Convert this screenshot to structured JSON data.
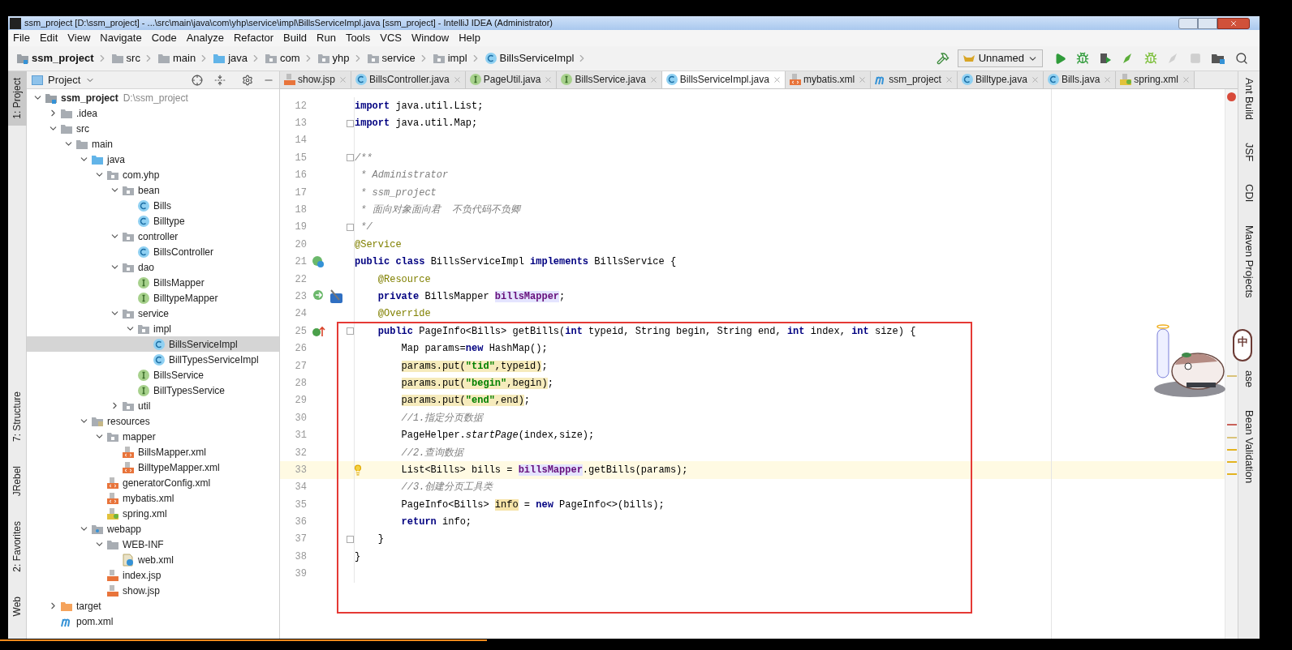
{
  "window": {
    "title": "ssm_project [D:\\ssm_project] - ...\\src\\main\\java\\com\\yhp\\service\\impl\\BillsServiceImpl.java [ssm_project] - IntelliJ IDEA (Administrator)"
  },
  "menu": [
    "File",
    "Edit",
    "View",
    "Navigate",
    "Code",
    "Analyze",
    "Refactor",
    "Build",
    "Run",
    "Tools",
    "VCS",
    "Window",
    "Help"
  ],
  "breadcrumbs": [
    {
      "label": "ssm_project",
      "kind": "module"
    },
    {
      "label": "src",
      "kind": "folder"
    },
    {
      "label": "main",
      "kind": "folder"
    },
    {
      "label": "java",
      "kind": "source"
    },
    {
      "label": "com",
      "kind": "package"
    },
    {
      "label": "yhp",
      "kind": "package"
    },
    {
      "label": "service",
      "kind": "package"
    },
    {
      "label": "impl",
      "kind": "package"
    },
    {
      "label": "BillsServiceImpl",
      "kind": "class"
    }
  ],
  "run_config": "Unnamed",
  "left_tools": [
    {
      "label": "1: Project",
      "selected": true
    },
    {
      "label": "7: Structure",
      "selected": false
    },
    {
      "label": "JRebel",
      "selected": false
    },
    {
      "label": "2: Favorites",
      "selected": false
    },
    {
      "label": "Web",
      "selected": false
    }
  ],
  "right_tools": [
    "Ant Build",
    "JSF",
    "CDI",
    "Maven Projects",
    "ase",
    "Bean Validation"
  ],
  "project_panel": {
    "title": "Project",
    "tree": [
      {
        "name": "ssm_project",
        "kind": "module",
        "bold": true,
        "path": "D:\\ssm_project",
        "expanded": true,
        "selected": false,
        "children": [
          {
            "name": ".idea",
            "kind": "folder",
            "bold": false,
            "expanded": false,
            "selected": false
          },
          {
            "name": "src",
            "kind": "folder",
            "bold": false,
            "expanded": true,
            "selected": false,
            "children": [
              {
                "name": "main",
                "kind": "folder",
                "bold": false,
                "expanded": true,
                "selected": false,
                "children": [
                  {
                    "name": "java",
                    "kind": "source",
                    "bold": false,
                    "expanded": true,
                    "selected": false,
                    "children": [
                      {
                        "name": "com.yhp",
                        "kind": "package",
                        "bold": false,
                        "expanded": true,
                        "selected": false,
                        "children": [
                          {
                            "name": "bean",
                            "kind": "package",
                            "bold": false,
                            "expanded": true,
                            "selected": false,
                            "children": [
                              {
                                "name": "Bills",
                                "kind": "class",
                                "bold": false,
                                "selected": false
                              },
                              {
                                "name": "Billtype",
                                "kind": "class",
                                "bold": false,
                                "selected": false
                              }
                            ]
                          },
                          {
                            "name": "controller",
                            "kind": "package",
                            "bold": false,
                            "expanded": true,
                            "selected": false,
                            "children": [
                              {
                                "name": "BillsController",
                                "kind": "class",
                                "bold": false,
                                "selected": false
                              }
                            ]
                          },
                          {
                            "name": "dao",
                            "kind": "package",
                            "bold": false,
                            "expanded": true,
                            "selected": false,
                            "children": [
                              {
                                "name": "BillsMapper",
                                "kind": "interface",
                                "bold": false,
                                "selected": false
                              },
                              {
                                "name": "BilltypeMapper",
                                "kind": "interface",
                                "bold": false,
                                "selected": false
                              }
                            ]
                          },
                          {
                            "name": "service",
                            "kind": "package",
                            "bold": false,
                            "expanded": true,
                            "selected": false,
                            "children": [
                              {
                                "name": "impl",
                                "kind": "package",
                                "bold": false,
                                "expanded": true,
                                "selected": false,
                                "children": [
                                  {
                                    "name": "BillsServiceImpl",
                                    "kind": "class",
                                    "bold": false,
                                    "selected": true
                                  },
                                  {
                                    "name": "BillTypesServiceImpl",
                                    "kind": "class",
                                    "bold": false,
                                    "selected": false
                                  }
                                ]
                              },
                              {
                                "name": "BillsService",
                                "kind": "interface",
                                "bold": false,
                                "selected": false
                              },
                              {
                                "name": "BillTypesService",
                                "kind": "interface",
                                "bold": false,
                                "selected": false
                              }
                            ]
                          },
                          {
                            "name": "util",
                            "kind": "package",
                            "bold": false,
                            "expanded": false,
                            "selected": false
                          }
                        ]
                      }
                    ]
                  },
                  {
                    "name": "resources",
                    "kind": "resources",
                    "bold": false,
                    "expanded": true,
                    "selected": false,
                    "children": [
                      {
                        "name": "mapper",
                        "kind": "package",
                        "bold": false,
                        "expanded": true,
                        "selected": false,
                        "children": [
                          {
                            "name": "BillsMapper.xml",
                            "kind": "xml",
                            "bold": false,
                            "selected": false
                          },
                          {
                            "name": "BilltypeMapper.xml",
                            "kind": "xml",
                            "bold": false,
                            "selected": false
                          }
                        ]
                      },
                      {
                        "name": "generatorConfig.xml",
                        "kind": "xml",
                        "bold": false,
                        "selected": false
                      },
                      {
                        "name": "mybatis.xml",
                        "kind": "xml",
                        "bold": false,
                        "selected": false
                      },
                      {
                        "name": "spring.xml",
                        "kind": "spring",
                        "bold": false,
                        "selected": false
                      }
                    ]
                  },
                  {
                    "name": "webapp",
                    "kind": "web",
                    "bold": false,
                    "expanded": true,
                    "selected": false,
                    "children": [
                      {
                        "name": "WEB-INF",
                        "kind": "folder",
                        "bold": false,
                        "expanded": true,
                        "selected": false,
                        "children": [
                          {
                            "name": "web.xml",
                            "kind": "webxml",
                            "bold": false,
                            "selected": false
                          }
                        ]
                      },
                      {
                        "name": "index.jsp",
                        "kind": "jsp",
                        "bold": false,
                        "selected": false
                      },
                      {
                        "name": "show.jsp",
                        "kind": "jsp",
                        "bold": false,
                        "selected": false
                      }
                    ]
                  }
                ]
              }
            ]
          },
          {
            "name": "target",
            "kind": "excluded",
            "bold": false,
            "expanded": false,
            "selected": false
          },
          {
            "name": "pom.xml",
            "kind": "maven",
            "bold": false,
            "selected": false
          }
        ]
      }
    ]
  },
  "tabs": [
    {
      "label": "show.jsp",
      "kind": "jsp",
      "selected": false
    },
    {
      "label": "BillsController.java",
      "kind": "class",
      "selected": false
    },
    {
      "label": "PageUtil.java",
      "kind": "interface",
      "selected": false
    },
    {
      "label": "BillsService.java",
      "kind": "interface",
      "selected": false
    },
    {
      "label": "BillsServiceImpl.java",
      "kind": "class",
      "selected": true
    },
    {
      "label": "mybatis.xml",
      "kind": "xml",
      "selected": false
    },
    {
      "label": "ssm_project",
      "kind": "maven",
      "selected": false
    },
    {
      "label": "Billtype.java",
      "kind": "class",
      "selected": false
    },
    {
      "label": "Bills.java",
      "kind": "class",
      "selected": false
    },
    {
      "label": "spring.xml",
      "kind": "spring",
      "selected": false
    }
  ],
  "code_lines": [
    {
      "number": "12",
      "current": false,
      "fold": false,
      "tokens": [
        {
          "kind": "keyword",
          "text": "import"
        },
        {
          "kind": "plain",
          "text": " java.util.List;"
        }
      ]
    },
    {
      "number": "13",
      "current": false,
      "fold": true,
      "tokens": [
        {
          "kind": "keyword",
          "text": "import"
        },
        {
          "kind": "plain",
          "text": " java.util.Map;"
        }
      ]
    },
    {
      "number": "14",
      "current": false,
      "fold": false
    },
    {
      "number": "15",
      "current": false,
      "fold": true,
      "tokens": [
        {
          "kind": "comment",
          "text": "/**"
        }
      ]
    },
    {
      "number": "16",
      "current": false,
      "fold": false,
      "tokens": [
        {
          "kind": "comment",
          "text": " * Administrator"
        }
      ]
    },
    {
      "number": "17",
      "current": false,
      "fold": false,
      "tokens": [
        {
          "kind": "comment",
          "text": " * ssm_project"
        }
      ]
    },
    {
      "number": "18",
      "current": false,
      "fold": false,
      "tokens": [
        {
          "kind": "comment",
          "text": " * 面向对象面向君  不负代码不负卿"
        }
      ]
    },
    {
      "number": "19",
      "current": false,
      "fold": true,
      "tokens": [
        {
          "kind": "comment",
          "text": " */"
        }
      ]
    },
    {
      "number": "20",
      "current": false,
      "fold": false,
      "tokens": [
        {
          "kind": "annotation",
          "text": "@Service"
        }
      ]
    },
    {
      "number": "21",
      "current": false,
      "fold": false,
      "kind": "class",
      "tokens": [
        {
          "kind": "keyword",
          "text": "public class"
        },
        {
          "kind": "plain",
          "text": " BillsServiceImpl "
        },
        {
          "kind": "keyword",
          "text": "implements"
        },
        {
          "kind": "plain",
          "text": " BillsService {"
        }
      ]
    },
    {
      "number": "22",
      "current": false,
      "fold": false,
      "tokens": [
        {
          "kind": "annotation",
          "text": "    @Resource"
        }
      ]
    },
    {
      "number": "23",
      "current": false,
      "fold": false,
      "kind": "bean",
      "tokens": [
        {
          "kind": "keyword",
          "text": "    private"
        },
        {
          "kind": "plain",
          "text": " BillsMapper "
        },
        {
          "kind": "field",
          "text": "billsMapper"
        },
        {
          "kind": "plain",
          "text": ";"
        }
      ]
    },
    {
      "number": "24",
      "current": false,
      "fold": false,
      "tokens": [
        {
          "kind": "annotation",
          "text": "    @Override"
        }
      ]
    },
    {
      "number": "25",
      "current": false,
      "fold": true,
      "kind": "implements",
      "tokens": [
        {
          "kind": "keyword",
          "text": "    public"
        },
        {
          "kind": "plain",
          "text": " PageInfo<Bills> getBills("
        },
        {
          "kind": "keyword",
          "text": "int"
        },
        {
          "kind": "plain",
          "text": " typeid, String begin, String end, "
        },
        {
          "kind": "keyword",
          "text": "int"
        },
        {
          "kind": "plain",
          "text": " index, "
        },
        {
          "kind": "keyword",
          "text": "int"
        },
        {
          "kind": "plain",
          "text": " size) {"
        }
      ]
    },
    {
      "number": "26",
      "current": false,
      "fold": false,
      "tokens": [
        {
          "kind": "plain",
          "text": "        Map params="
        },
        {
          "kind": "keyword",
          "text": "new"
        },
        {
          "kind": "plain",
          "text": " HashMap();"
        }
      ]
    },
    {
      "number": "27",
      "current": false,
      "fold": false,
      "tokens": [
        {
          "kind": "warning",
          "text": "        params.put("
        },
        {
          "kind": "string",
          "text": "\"tid\""
        },
        {
          "kind": "warning",
          "text": ",typeid)"
        },
        {
          "kind": "plain",
          "text": ";"
        }
      ]
    },
    {
      "number": "28",
      "current": false,
      "fold": false,
      "tokens": [
        {
          "kind": "warning",
          "text": "        params.put("
        },
        {
          "kind": "string",
          "text": "\"begin\""
        },
        {
          "kind": "warning",
          "text": ",begin)"
        },
        {
          "kind": "plain",
          "text": ";"
        }
      ]
    },
    {
      "number": "29",
      "current": false,
      "fold": false,
      "tokens": [
        {
          "kind": "warning",
          "text": "        params.put("
        },
        {
          "kind": "string",
          "text": "\"end\""
        },
        {
          "kind": "warning",
          "text": ",end)"
        },
        {
          "kind": "plain",
          "text": ";"
        }
      ]
    },
    {
      "number": "30",
      "current": false,
      "fold": false,
      "tokens": [
        {
          "kind": "comment",
          "text": "        //1.指定分页数据"
        }
      ]
    },
    {
      "number": "31",
      "current": false,
      "fold": false,
      "tokens": [
        {
          "kind": "plain",
          "text": "        PageHelper."
        },
        {
          "kind": "static",
          "text": "startPage"
        },
        {
          "kind": "plain",
          "text": "(index,size);"
        }
      ]
    },
    {
      "number": "32",
      "current": false,
      "fold": false,
      "tokens": [
        {
          "kind": "comment",
          "text": "        //2.查询数据"
        }
      ]
    },
    {
      "number": "33",
      "current": true,
      "fold": false,
      "kind": "bulb",
      "tokens": [
        {
          "kind": "plain",
          "text": "        List<Bills> bills = "
        },
        {
          "kind": "field",
          "text": "billsMapper"
        },
        {
          "kind": "plain",
          "text": ".getBills(params);"
        }
      ]
    },
    {
      "number": "34",
      "current": false,
      "fold": false,
      "tokens": [
        {
          "kind": "comment",
          "text": "        //3.创建分页工具类"
        }
      ]
    },
    {
      "number": "35",
      "current": false,
      "fold": false,
      "tokens": [
        {
          "kind": "plain",
          "text": "        PageInfo<Bills> "
        },
        {
          "kind": "usage",
          "text": "info"
        },
        {
          "kind": "plain",
          "text": " = "
        },
        {
          "kind": "keyword",
          "text": "new"
        },
        {
          "kind": "plain",
          "text": " PageInfo<>(bills);"
        }
      ]
    },
    {
      "number": "36",
      "current": false,
      "fold": false,
      "tokens": [
        {
          "kind": "keyword",
          "text": "        return"
        },
        {
          "kind": "plain",
          "text": " info;"
        }
      ]
    },
    {
      "number": "37",
      "current": false,
      "fold": true,
      "tokens": [
        {
          "kind": "plain",
          "text": "    }"
        }
      ]
    },
    {
      "number": "38",
      "current": false,
      "fold": false,
      "tokens": [
        {
          "kind": "plain",
          "text": "}"
        }
      ]
    },
    {
      "number": "39",
      "current": false,
      "fold": false
    }
  ],
  "ime_badge": "中"
}
